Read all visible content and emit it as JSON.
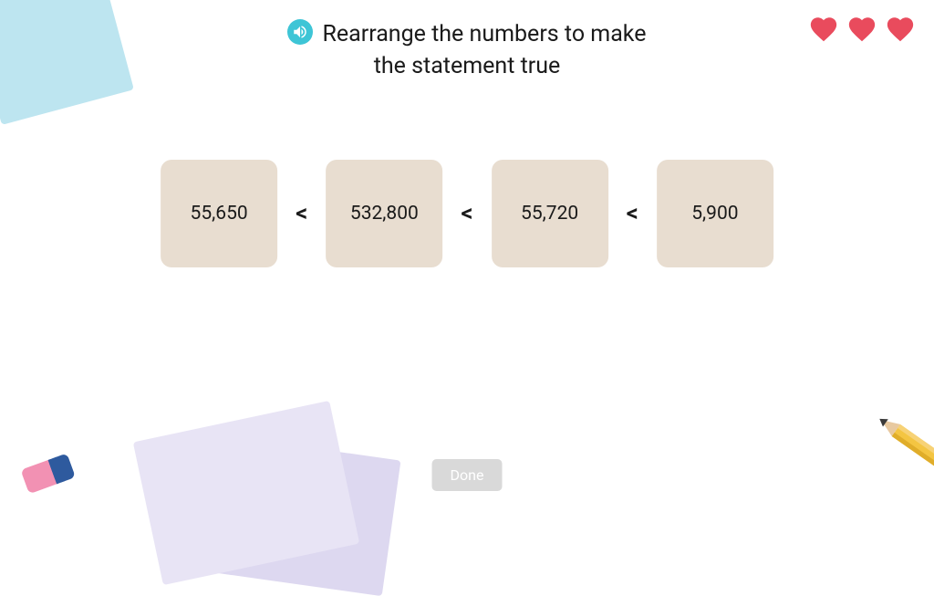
{
  "instruction": {
    "line1": "Rearrange the numbers to make",
    "line2": "the statement true"
  },
  "hearts": {
    "count": 3
  },
  "tiles": [
    {
      "value": "55,650"
    },
    {
      "value": "532,800"
    },
    {
      "value": "55,720"
    },
    {
      "value": "5,900"
    }
  ],
  "comparator": "<",
  "doneButton": {
    "label": "Done"
  }
}
